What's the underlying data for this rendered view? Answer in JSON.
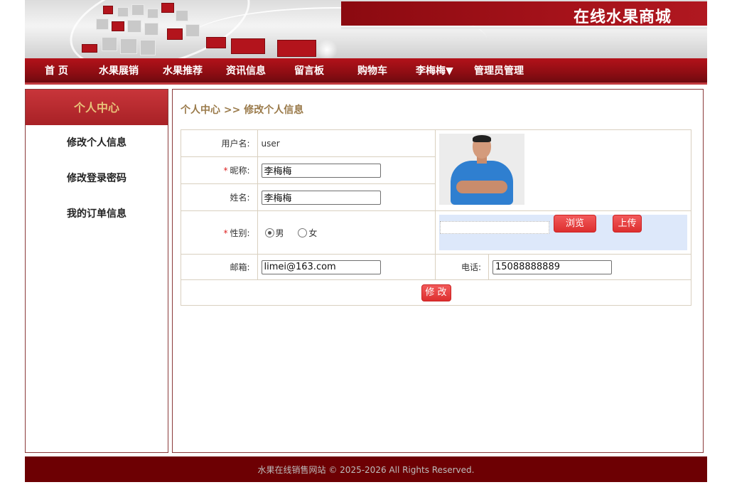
{
  "header": {
    "site_title": "在线水果商城"
  },
  "nav": {
    "items": [
      {
        "label": "首 页"
      },
      {
        "label": "水果展销"
      },
      {
        "label": "水果推荐"
      },
      {
        "label": "资讯信息"
      },
      {
        "label": "留言板"
      },
      {
        "label": "购物车"
      },
      {
        "label": "李梅梅▼"
      },
      {
        "label": "管理员管理"
      }
    ]
  },
  "sidebar": {
    "title": "个人中心",
    "items": [
      {
        "label": "修改个人信息"
      },
      {
        "label": "修改登录密码"
      },
      {
        "label": "我的订单信息"
      }
    ]
  },
  "main": {
    "breadcrumb": {
      "root": "个人中心",
      "separator": ">>",
      "current": "修改个人信息"
    },
    "form": {
      "username_label": "用户名:",
      "username_value": "user",
      "required_mark": "*",
      "nickname_label": "昵称:",
      "nickname_value": "李梅梅",
      "realname_label": "姓名:",
      "realname_value": "李梅梅",
      "gender_label": "性别:",
      "gender_options": [
        {
          "label": "男",
          "selected": true
        },
        {
          "label": "女",
          "selected": false
        }
      ],
      "email_label": "邮箱:",
      "email_value": "limei@163.com",
      "phone_label": "电话:",
      "phone_value": "15088888889",
      "browse_button": "浏览",
      "upload_button": "上传",
      "submit_button": "修 改"
    }
  },
  "footer": {
    "text": "水果在线销售网站  © 2025-2026 All Rights Reserved."
  },
  "colors": {
    "nav_red": "#8e0d13",
    "footer_red": "#6d0003",
    "button_red": "#e23b3b",
    "breadcrumb_brown": "#9a7a4a"
  }
}
